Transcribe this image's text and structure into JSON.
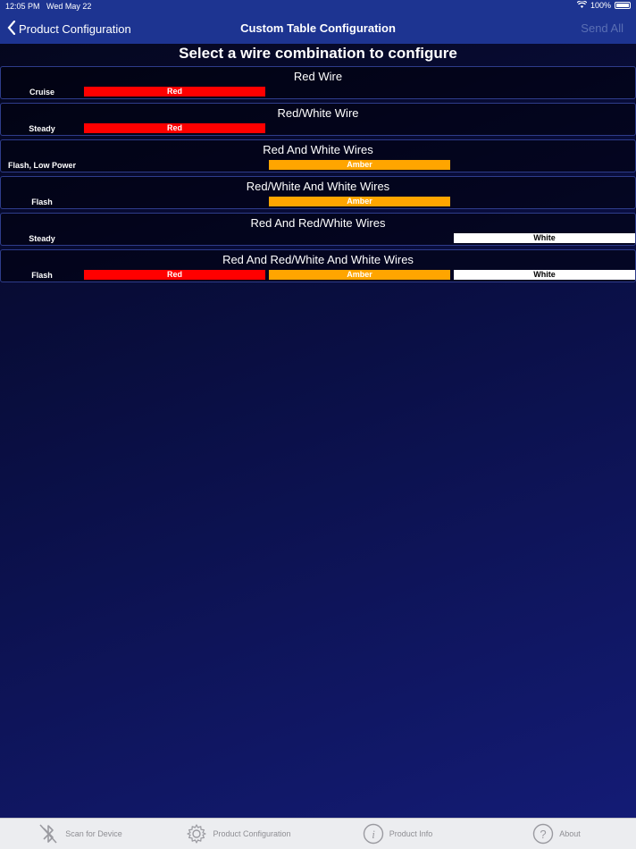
{
  "status": {
    "time": "12:05 PM",
    "date": "Wed May 22",
    "battery": "100%"
  },
  "nav": {
    "back_label": "Product Configuration",
    "title": "Custom Table Configuration",
    "action_label": "Send All"
  },
  "heading": "Select a wire combination to configure",
  "rows": [
    {
      "title": "Red Wire",
      "mode": "Cruise",
      "slots": [
        "Red",
        "",
        ""
      ]
    },
    {
      "title": "Red/White Wire",
      "mode": "Steady",
      "slots": [
        "Red",
        "",
        ""
      ]
    },
    {
      "title": "Red And White Wires",
      "mode": "Flash, Low Power",
      "slots": [
        "",
        "Amber",
        ""
      ]
    },
    {
      "title": "Red/White And White Wires",
      "mode": "Flash",
      "slots": [
        "",
        "Amber",
        ""
      ]
    },
    {
      "title": "Red And Red/White Wires",
      "mode": "Steady",
      "slots": [
        "",
        "",
        "White"
      ]
    },
    {
      "title": "Red And Red/White And White Wires",
      "mode": "Flash",
      "slots": [
        "Red",
        "Amber",
        "White"
      ]
    }
  ],
  "colors": {
    "Red": "#ff0000",
    "Amber": "#ffa500",
    "White": "#ffffff",
    "nav": "#1d3491"
  },
  "tabs": [
    {
      "label": "Scan for Device",
      "icon": "bluetooth-icon"
    },
    {
      "label": "Product Configuration",
      "icon": "gear-icon"
    },
    {
      "label": "Product Info",
      "icon": "info-icon"
    },
    {
      "label": "About",
      "icon": "question-icon"
    }
  ]
}
